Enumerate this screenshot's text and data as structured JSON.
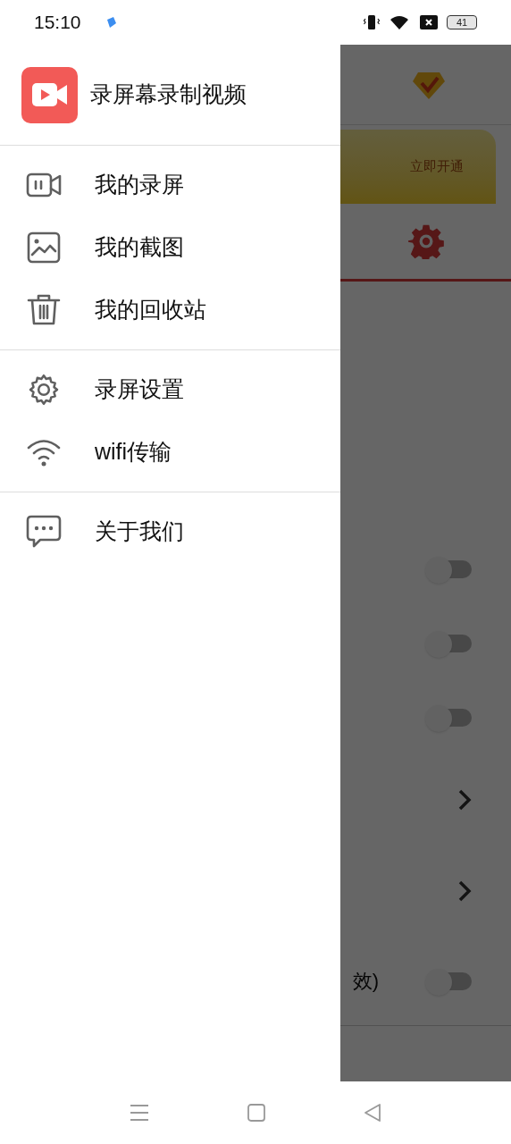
{
  "status_bar": {
    "time": "15:10",
    "battery": "41"
  },
  "drawer": {
    "app_title": "录屏幕录制视频",
    "groups": [
      [
        {
          "label": "我的录屏"
        },
        {
          "label": "我的截图"
        },
        {
          "label": "我的回收站"
        }
      ],
      [
        {
          "label": "录屏设置"
        },
        {
          "label": "wifi传输"
        }
      ],
      [
        {
          "label": "关于我们"
        }
      ]
    ]
  },
  "background": {
    "banner_action": "立即开通",
    "rows": [
      {
        "kind": "toggle",
        "on": false
      },
      {
        "kind": "toggle",
        "on": false
      },
      {
        "kind": "toggle",
        "on": false
      },
      {
        "kind": "chevron"
      },
      {
        "kind": "chevron"
      },
      {
        "kind": "toggle",
        "on": false,
        "label": "效)"
      }
    ]
  }
}
